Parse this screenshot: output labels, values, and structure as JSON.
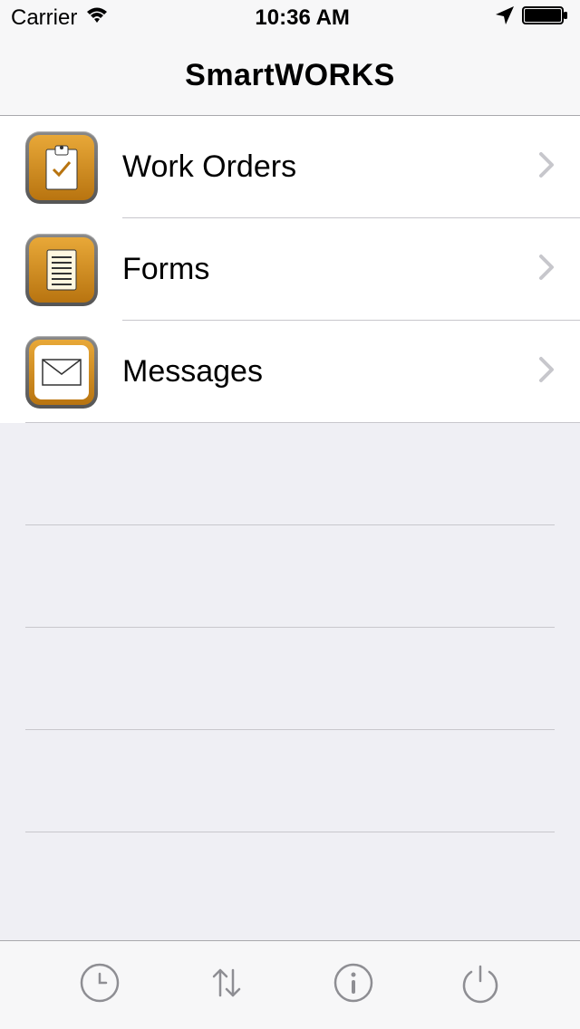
{
  "status": {
    "carrier": "Carrier",
    "time": "10:36 AM"
  },
  "nav": {
    "title": "SmartWORKS"
  },
  "menu": {
    "items": [
      {
        "label": "Work Orders",
        "icon": "clipboard"
      },
      {
        "label": "Forms",
        "icon": "document"
      },
      {
        "label": "Messages",
        "icon": "envelope"
      }
    ]
  }
}
